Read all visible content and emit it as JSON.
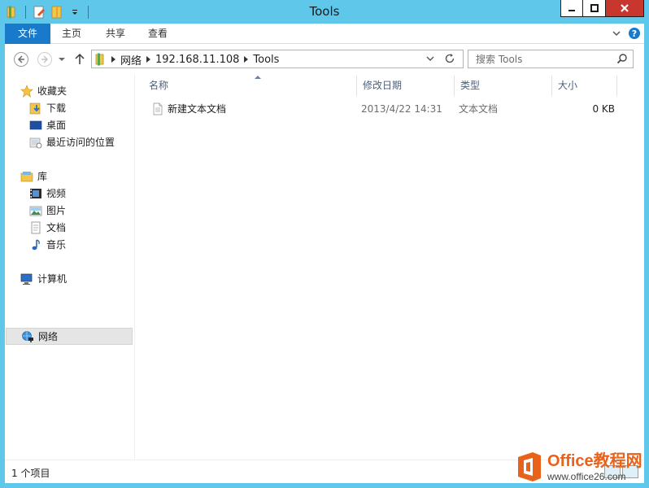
{
  "window": {
    "title": "Tools"
  },
  "ribbon": {
    "tabs": [
      {
        "label": "文件"
      },
      {
        "label": "主页"
      },
      {
        "label": "共享"
      },
      {
        "label": "查看"
      }
    ]
  },
  "address": {
    "crumbs": [
      "网络",
      "192.168.11.108",
      "Tools"
    ]
  },
  "search": {
    "placeholder": "搜索 Tools"
  },
  "sidebar": {
    "favorites": {
      "label": "收藏夹",
      "items": [
        "下载",
        "桌面",
        "最近访问的位置"
      ]
    },
    "libraries": {
      "label": "库",
      "items": [
        "视频",
        "图片",
        "文档",
        "音乐"
      ]
    },
    "computer": {
      "label": "计算机"
    },
    "network": {
      "label": "网络"
    }
  },
  "columns": [
    "名称",
    "修改日期",
    "类型",
    "大小"
  ],
  "files": [
    {
      "name": "新建文本文档",
      "modified": "2013/4/22 14:31",
      "type": "文本文档",
      "size": "0 KB"
    }
  ],
  "status": {
    "item_count": "1 个项目"
  },
  "watermark": {
    "brand": "Office教程网",
    "url": "www.office26.com"
  },
  "colors": {
    "titlebar": "#5fc7ea",
    "file_tab": "#1979ca",
    "close_button": "#c7372d",
    "watermark_orange": "#e8621a"
  }
}
